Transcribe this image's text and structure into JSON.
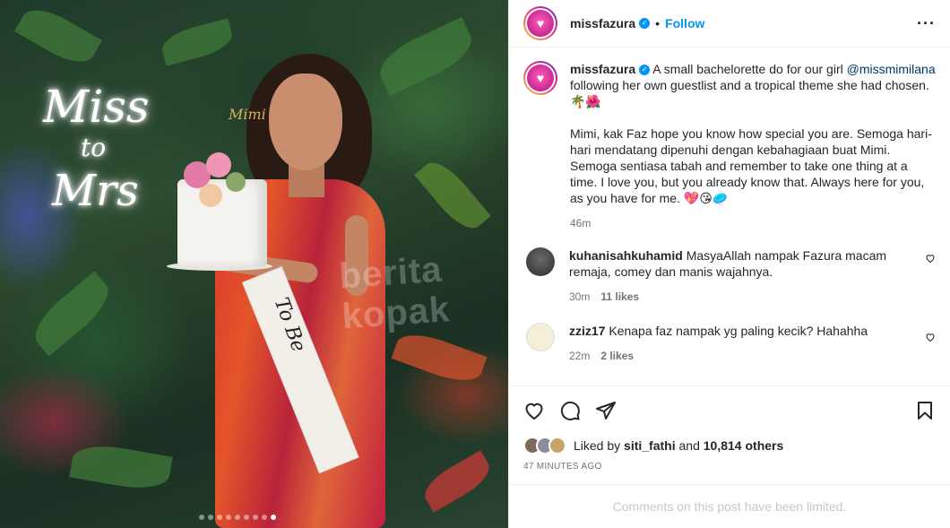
{
  "post": {
    "username": "missfazura",
    "verified_icon": "verified-badge-icon",
    "follow_label": "Follow",
    "separator": "•",
    "more_icon": "more-options-icon"
  },
  "photo": {
    "neon_line1": "Miss",
    "neon_line2": "to",
    "neon_line3": "Mrs",
    "topper": "Mimi",
    "sash": "To Be",
    "watermark": "berita kopak",
    "carousel_count": 9,
    "carousel_active": 8
  },
  "caption": {
    "username": "missfazura",
    "text1": " A small bachelorette do for our girl ",
    "mention": "@missmimilana",
    "text2": " following her own guestlist and a tropical theme she had chosen. 🌴🌺",
    "para2": "Mimi, kak Faz hope you know how special you are. Semoga hari-hari mendatang dipenuhi dengan kebahagiaan buat Mimi. Semoga sentiasa tabah and remember to take one thing at a time. I love you, but you already know that. Always here for you, as you have for me. 💖😘🥏",
    "time": "46m"
  },
  "comments": [
    {
      "username": "kuhanisahkuhamid",
      "text": " MasyaAllah nampak Fazura macam remaja, comey dan manis wajahnya.",
      "time": "30m",
      "likes": "11 likes"
    },
    {
      "username": "zziz17",
      "text": " Kenapa faz nampak yg paling kecik? Hahahha",
      "time": "22m",
      "likes": "2 likes"
    }
  ],
  "actions": {
    "like_icon": "heart-icon",
    "comment_icon": "comment-icon",
    "share_icon": "share-icon",
    "save_icon": "bookmark-icon",
    "liked_prefix": "Liked by ",
    "liked_user": "siti_fathi",
    "liked_mid": " and ",
    "liked_count": "10,814 others",
    "ago": "47 MINUTES AGO"
  },
  "footer": {
    "limited": "Comments on this post have been limited."
  },
  "colors": {
    "accent": "#0095f6",
    "text": "#262626",
    "muted": "#737373",
    "disabled": "#c7c7c7"
  }
}
